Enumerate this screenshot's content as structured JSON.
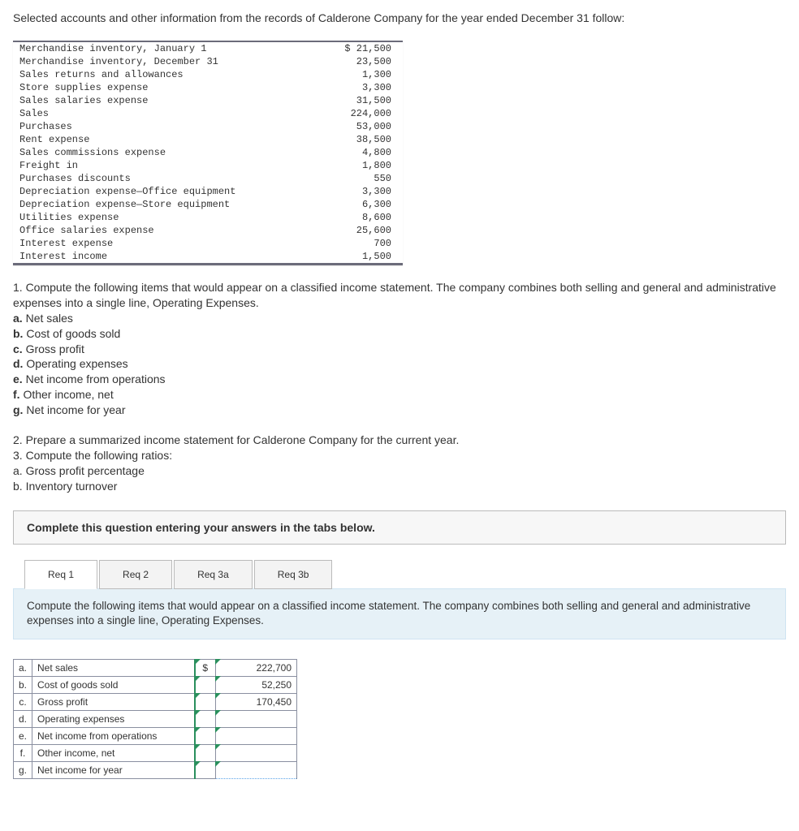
{
  "intro": "Selected accounts and other information from the records of Calderone Company for the year ended December 31 follow:",
  "accounts": [
    {
      "label": "Merchandise inventory, January 1",
      "value": "$ 21,500"
    },
    {
      "label": "Merchandise inventory, December 31",
      "value": "23,500"
    },
    {
      "label": "Sales returns and allowances",
      "value": "1,300"
    },
    {
      "label": "Store supplies expense",
      "value": "3,300"
    },
    {
      "label": "Sales salaries expense",
      "value": "31,500"
    },
    {
      "label": "Sales",
      "value": "224,000"
    },
    {
      "label": "Purchases",
      "value": "53,000"
    },
    {
      "label": "Rent expense",
      "value": "38,500"
    },
    {
      "label": "Sales commissions expense",
      "value": "4,800"
    },
    {
      "label": "Freight in",
      "value": "1,800"
    },
    {
      "label": "Purchases discounts",
      "value": "550"
    },
    {
      "label": "Depreciation expense—Office equipment",
      "value": "3,300"
    },
    {
      "label": "Depreciation expense—Store equipment",
      "value": "6,300"
    },
    {
      "label": "Utilities expense",
      "value": "8,600"
    },
    {
      "label": "Office salaries expense",
      "value": "25,600"
    },
    {
      "label": "Interest expense",
      "value": "700"
    },
    {
      "label": "Interest income",
      "value": "1,500"
    }
  ],
  "q1": {
    "lead": "1. Compute the following items that would appear on a classified income statement. The company combines both selling and general and administrative expenses into a single line, Operating Expenses.",
    "items": [
      {
        "l": "a.",
        "t": "Net sales"
      },
      {
        "l": "b.",
        "t": "Cost of goods sold"
      },
      {
        "l": "c.",
        "t": "Gross profit"
      },
      {
        "l": "d.",
        "t": "Operating expenses"
      },
      {
        "l": "e.",
        "t": "Net income from operations"
      },
      {
        "l": "f.",
        "t": "Other income, net"
      },
      {
        "l": "g.",
        "t": "Net income for year"
      }
    ]
  },
  "q2": "2. Prepare a summarized income statement for Calderone Company for the current year.",
  "q3": {
    "lead": "3. Compute the following ratios:",
    "a": "a. Gross profit percentage",
    "b": "b. Inventory turnover"
  },
  "completeBar": "Complete this question entering your answers in the tabs below.",
  "tabs": [
    "Req 1",
    "Req 2",
    "Req 3a",
    "Req 3b"
  ],
  "panelText": "Compute the following items that would appear on a classified income statement. The company combines both selling and general and administrative expenses into a single line, Operating Expenses.",
  "answers": [
    {
      "l": "a.",
      "label": "Net sales",
      "dollar": "$",
      "value": "222,700"
    },
    {
      "l": "b.",
      "label": "Cost of goods sold",
      "dollar": "",
      "value": "52,250"
    },
    {
      "l": "c.",
      "label": "Gross profit",
      "dollar": "",
      "value": "170,450"
    },
    {
      "l": "d.",
      "label": "Operating expenses",
      "dollar": "",
      "value": ""
    },
    {
      "l": "e.",
      "label": "Net income from operations",
      "dollar": "",
      "value": ""
    },
    {
      "l": "f.",
      "label": "Other income, net",
      "dollar": "",
      "value": ""
    },
    {
      "l": "g.",
      "label": "Net income for year",
      "dollar": "",
      "value": ""
    }
  ]
}
